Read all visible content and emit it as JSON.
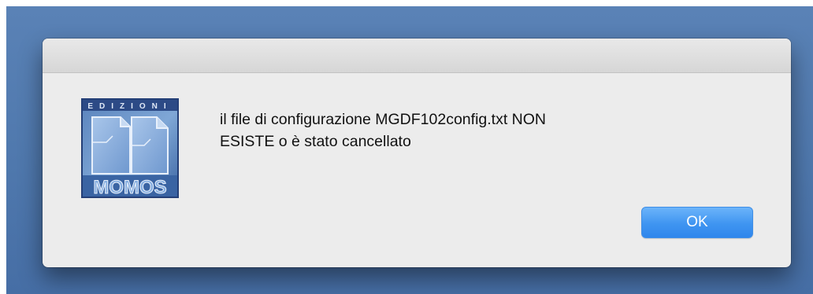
{
  "dialog": {
    "app_logo": {
      "top_text": "EDIZIONI",
      "bottom_text": "MOMOS",
      "icon": "edizioni-momos-logo"
    },
    "message_lines": [
      "il file di configurazione MGDF102config.txt NON",
      "ESISTE o è stato cancellato"
    ],
    "ok_label": "OK"
  },
  "colors": {
    "desktop_background": "#5a82b6",
    "dialog_background": "#ececec",
    "button_accent": "#3f95f1"
  }
}
